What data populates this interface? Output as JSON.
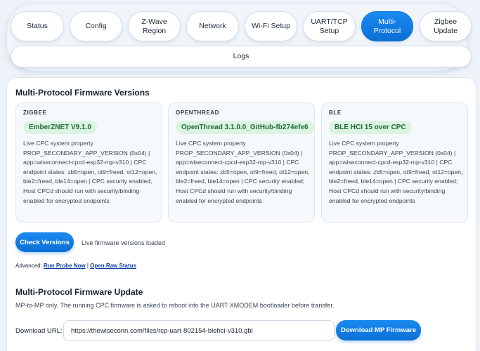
{
  "nav": {
    "tabs": [
      {
        "label": "Status",
        "active": false
      },
      {
        "label": "Config",
        "active": false
      },
      {
        "label": "Z-Wave\nRegion",
        "active": false
      },
      {
        "label": "Network",
        "active": false
      },
      {
        "label": "Wi-Fi Setup",
        "active": false
      },
      {
        "label": "UART/TCP\nSetup",
        "active": false
      },
      {
        "label": "Multi-\nProtocol",
        "active": true
      },
      {
        "label": "Zigbee\nUpdate",
        "active": false
      }
    ],
    "logs_label": "Logs"
  },
  "versions": {
    "title": "Multi-Protocol Firmware Versions",
    "boxes": [
      {
        "label": "ZIGBEE",
        "badge": "EmberZNET V9.1.0",
        "desc": "Live CPC system property PROP_SECONDARY_APP_VERSION (0x04) | app=wiseconnect-cpcd-esp32-mp-v310 | CPC endpoint states: zb5=open, ot9=freed, ot12=open, ble2=freed, ble14=open | CPC security enabled; Host CPCd should run with security/binding enabled for encrypted endpoints"
      },
      {
        "label": "OPENTHREAD",
        "badge": "OpenThread 3.1.0.0_GitHub-fb274efe6",
        "desc": "Live CPC system property PROP_SECONDARY_APP_VERSION (0x04) | app=wiseconnect-cpcd-esp32-mp-v310 | CPC endpoint states: zb5=open, ot9=freed, ot12=open, ble2=freed, ble14=open | CPC security enabled; Host CPCd should run with security/binding enabled for encrypted endpoints"
      },
      {
        "label": "BLE",
        "badge": "BLE HCI 15 over CPC",
        "desc": "Live CPC system property PROP_SECONDARY_APP_VERSION (0x04) | app=wiseconnect-cpcd-esp32-mp-v310 | CPC endpoint states: zb5=open, ot9=freed, ot12=open, ble2=freed, ble14=open | CPC security enabled; Host CPCd should run with security/binding enabled for encrypted endpoints"
      }
    ],
    "check_button": "Check Versions",
    "status": "Live firmware versions loaded",
    "advanced_prefix": "Advanced:",
    "run_probe_link": "Run Probe Now",
    "separator": "|",
    "raw_status_link": "Open Raw Status"
  },
  "update": {
    "title": "Multi-Protocol Firmware Update",
    "note": "MP-to-MP only. The running CPC firmware is asked to reboot into the UART XMODEM bootloader before transfer.",
    "url_label": "Download URL:",
    "url_value": "https://thewiseconn.com/files/rcp-uart-802154-blehci-v310.gbl",
    "download_button": "Download MP Firmware"
  },
  "colors": {
    "accent": "#0b6fd6",
    "badge_bg": "#dcf3e2",
    "badge_text": "#1e6b36",
    "page_bg": "#eef3f9"
  }
}
